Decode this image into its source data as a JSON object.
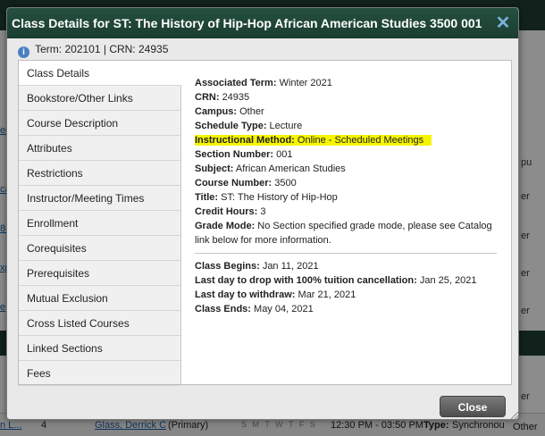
{
  "dialog": {
    "title": "Class Details for ST: The History of Hip-Hop African American Studies 3500 001",
    "term_label": "Term:",
    "term_value": "202101",
    "crn_label": "CRN:",
    "crn_value": "24935",
    "close_label": "Close"
  },
  "tabs": [
    {
      "label": "Class Details"
    },
    {
      "label": "Bookstore/Other Links"
    },
    {
      "label": "Course Description"
    },
    {
      "label": "Attributes"
    },
    {
      "label": "Restrictions"
    },
    {
      "label": "Instructor/Meeting Times"
    },
    {
      "label": "Enrollment"
    },
    {
      "label": "Corequisites"
    },
    {
      "label": "Prerequisites"
    },
    {
      "label": "Mutual Exclusion"
    },
    {
      "label": "Cross Listed Courses"
    },
    {
      "label": "Linked Sections"
    },
    {
      "label": "Fees"
    }
  ],
  "details": {
    "associated_term": {
      "label": "Associated Term:",
      "value": "Winter 2021"
    },
    "crn": {
      "label": "CRN:",
      "value": "24935"
    },
    "campus": {
      "label": "Campus:",
      "value": "Other"
    },
    "schedule_type": {
      "label": "Schedule Type:",
      "value": "Lecture"
    },
    "instructional_method": {
      "label": "Instructional Method:",
      "value": "Online - Scheduled Meetings"
    },
    "section_number": {
      "label": "Section Number:",
      "value": "001"
    },
    "subject": {
      "label": "Subject:",
      "value": "African American Studies"
    },
    "course_number": {
      "label": "Course Number:",
      "value": "3500"
    },
    "title": {
      "label": "Title:",
      "value": "ST: The History of Hip-Hop"
    },
    "credit_hours": {
      "label": "Credit Hours:",
      "value": "3"
    },
    "grade_mode": {
      "label": "Grade Mode:",
      "value": "No Section specified grade mode, please see Catalog link below for more information."
    }
  },
  "dates": {
    "class_begins": {
      "label": "Class Begins:",
      "value": "Jan 11, 2021"
    },
    "last_drop": {
      "label": "Last day to drop with 100% tuition cancellation:",
      "value": "Jan 25, 2021"
    },
    "last_withdraw": {
      "label": "Last day to withdraw:",
      "value": "Mar 21, 2021"
    },
    "class_ends": {
      "label": "Class Ends:",
      "value": "May 04, 2021"
    }
  },
  "background": {
    "row_number": "4",
    "instructor": "Glass, Derrick C",
    "instructor_role": "(Primary)",
    "days": "S M T W T F S",
    "time": "12:30 PM - 03:50 PM",
    "type_label": "Type:",
    "type_value": "Synchronou",
    "other": "Other"
  },
  "colors": {
    "titlebar": "#1f3f35",
    "highlight": "#f5f500",
    "close_x": "#7bb0d8"
  }
}
